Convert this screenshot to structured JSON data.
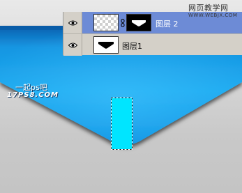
{
  "layers_panel": {
    "layers": [
      {
        "name": "图层 2",
        "selected": true,
        "visible": true,
        "thumbnail": "transparent-checker",
        "has_mask": true,
        "linked": true
      },
      {
        "name": "图层1",
        "selected": false,
        "visible": true,
        "thumbnail": "black-shape-on-white",
        "has_mask": false,
        "linked": false
      }
    ]
  },
  "watermark": {
    "site_title": "网页教学网",
    "site_url": "WWW.WEBJX.COM",
    "overlay_cn": "一起ps吧",
    "overlay_url": "17PS8.COM"
  },
  "colors": {
    "shape_blue_top": "#0b6fc2",
    "shape_blue_mid": "#1aa3ec",
    "shape_blue_bottom": "#0a8fe0",
    "selection_fill": "#00e5ff",
    "panel_selected": "#6d8bd6",
    "panel_bg": "#d4d0c8"
  },
  "icons": [
    "eye-icon",
    "chain-link-icon",
    "layer-mask-thumbnail",
    "marquee-selection"
  ]
}
